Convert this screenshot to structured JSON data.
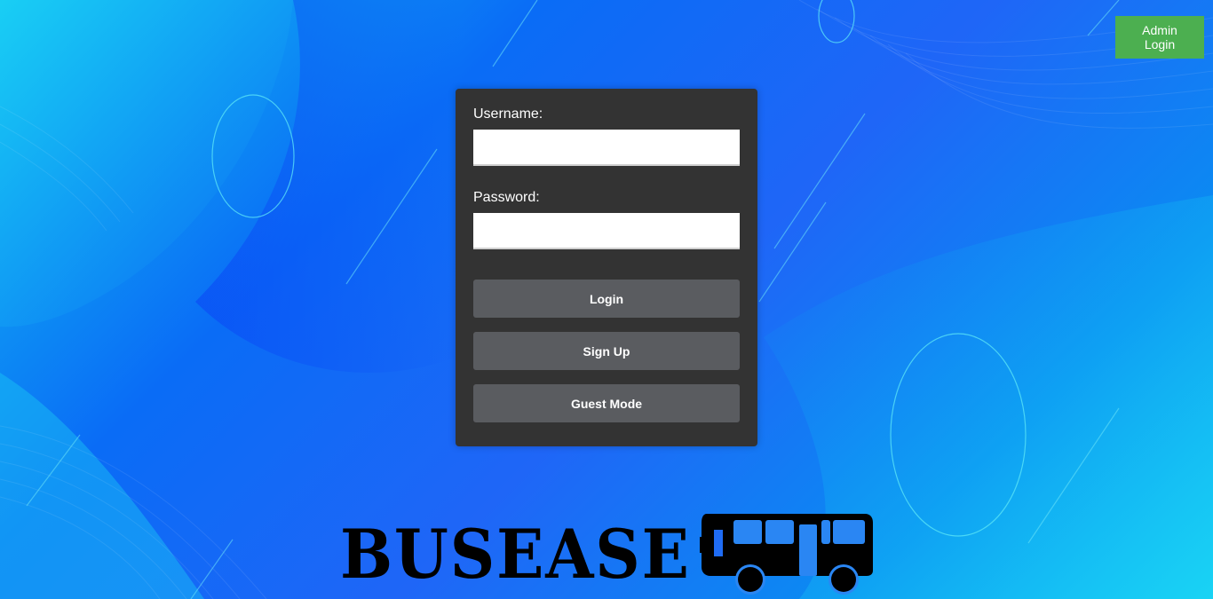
{
  "header": {
    "admin_login_label": "Admin Login"
  },
  "login_form": {
    "username_label": "Username:",
    "username_value": "",
    "password_label": "Password:",
    "password_value": "",
    "login_button": "Login",
    "signup_button": "Sign Up",
    "guest_button": "Guest Mode"
  },
  "branding": {
    "logo_text": "BUSEASE",
    "logo_icon": "bus-icon"
  },
  "colors": {
    "card_bg": "#333333",
    "button_bg": "#5a5c60",
    "admin_button_bg": "#4caf50",
    "background_primary": "#1f66f7",
    "background_accent": "#15c4f2"
  }
}
